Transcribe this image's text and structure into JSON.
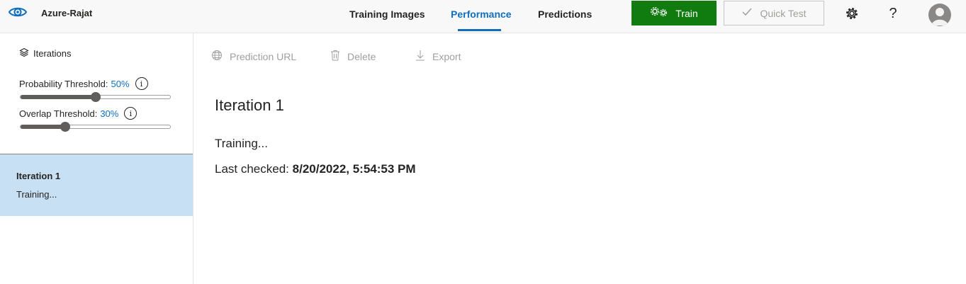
{
  "header": {
    "project_name": "Azure-Rajat",
    "tabs": [
      {
        "label": "Training Images",
        "active": false
      },
      {
        "label": "Performance",
        "active": true
      },
      {
        "label": "Predictions",
        "active": false
      }
    ],
    "train_label": "Train",
    "quick_test_label": "Quick Test",
    "help_glyph": "?",
    "icons": [
      "eye-logo-icon",
      "gears-icon",
      "checkmark-icon",
      "settings-gear-icon",
      "help-icon",
      "user-avatar-icon"
    ]
  },
  "sidebar": {
    "heading": "Iterations",
    "probability": {
      "label": "Probability Threshold:",
      "value": "50%",
      "fraction": 0.5
    },
    "overlap": {
      "label": "Overlap Threshold:",
      "value": "30%",
      "fraction": 0.3
    },
    "info_glyph": "i",
    "iterations": [
      {
        "name": "Iteration 1",
        "status": "Training...",
        "selected": true
      }
    ]
  },
  "toolbar": {
    "prediction_url": "Prediction URL",
    "delete": "Delete",
    "export": "Export"
  },
  "main": {
    "title": "Iteration 1",
    "status": "Training...",
    "last_checked_label": "Last checked:",
    "last_checked_value": "8/20/2022, 5:54:53 PM"
  },
  "colors": {
    "accent": "#106ebe",
    "train_button": "#107c10",
    "selected_iteration": "#c7e0f4"
  }
}
